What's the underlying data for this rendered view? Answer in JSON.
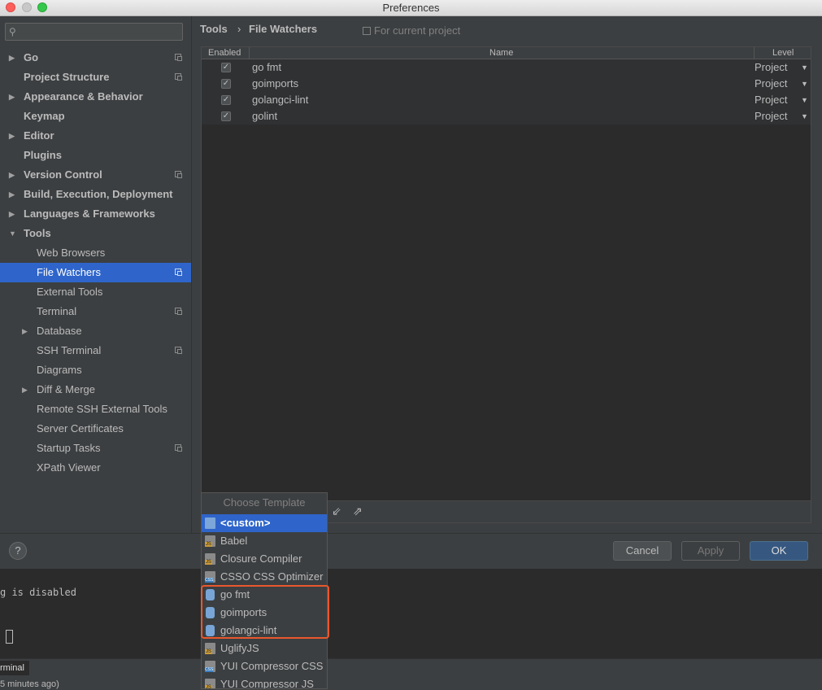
{
  "window": {
    "title": "Preferences"
  },
  "sidebar": {
    "search_placeholder": "",
    "items": [
      {
        "label": "Go",
        "arrow": "▶",
        "bold": true,
        "proj": true
      },
      {
        "label": "Project Structure",
        "arrow": "",
        "bold": true,
        "proj": true
      },
      {
        "label": "Appearance & Behavior",
        "arrow": "▶",
        "bold": true,
        "proj": false
      },
      {
        "label": "Keymap",
        "arrow": "",
        "bold": true,
        "proj": false
      },
      {
        "label": "Editor",
        "arrow": "▶",
        "bold": true,
        "proj": false
      },
      {
        "label": "Plugins",
        "arrow": "",
        "bold": true,
        "proj": false
      },
      {
        "label": "Version Control",
        "arrow": "▶",
        "bold": true,
        "proj": true
      },
      {
        "label": "Build, Execution, Deployment",
        "arrow": "▶",
        "bold": true,
        "proj": false
      },
      {
        "label": "Languages & Frameworks",
        "arrow": "▶",
        "bold": true,
        "proj": false
      },
      {
        "label": "Tools",
        "arrow": "▼",
        "bold": true,
        "proj": false
      },
      {
        "label": "Web Browsers",
        "arrow": "",
        "bold": false,
        "proj": false
      },
      {
        "label": "File Watchers",
        "arrow": "",
        "bold": false,
        "proj": true,
        "selected": true
      },
      {
        "label": "External Tools",
        "arrow": "",
        "bold": false,
        "proj": false
      },
      {
        "label": "Terminal",
        "arrow": "",
        "bold": false,
        "proj": true
      },
      {
        "label": "Database",
        "arrow": "▶",
        "bold": false,
        "proj": false
      },
      {
        "label": "SSH Terminal",
        "arrow": "",
        "bold": false,
        "proj": true
      },
      {
        "label": "Diagrams",
        "arrow": "",
        "bold": false,
        "proj": false
      },
      {
        "label": "Diff & Merge",
        "arrow": "▶",
        "bold": false,
        "proj": false
      },
      {
        "label": "Remote SSH External Tools",
        "arrow": "",
        "bold": false,
        "proj": false
      },
      {
        "label": "Server Certificates",
        "arrow": "",
        "bold": false,
        "proj": false
      },
      {
        "label": "Startup Tasks",
        "arrow": "",
        "bold": false,
        "proj": true
      },
      {
        "label": "XPath Viewer",
        "arrow": "",
        "bold": false,
        "proj": false
      }
    ]
  },
  "breadcrumb": {
    "parent": "Tools",
    "separator": "›",
    "current": "File Watchers",
    "scope": "For current project"
  },
  "table": {
    "headers": {
      "enabled": "Enabled",
      "name": "Name",
      "level": "Level"
    },
    "rows": [
      {
        "checked": "✓",
        "name": "go fmt",
        "level": "Project"
      },
      {
        "checked": "✓",
        "name": "goimports",
        "level": "Project"
      },
      {
        "checked": "✓",
        "name": "golangci-lint",
        "level": "Project"
      },
      {
        "checked": "✓",
        "name": "golint",
        "level": "Project"
      }
    ]
  },
  "footer_icons": {
    "import": "⇙",
    "export": "⇗"
  },
  "buttons": {
    "help": "?",
    "cancel": "Cancel",
    "apply": "Apply",
    "ok": "OK"
  },
  "popup": {
    "title": "Choose Template",
    "items": [
      {
        "label": "<custom>",
        "icon": "custom",
        "selected": true
      },
      {
        "label": "Babel",
        "icon": "js"
      },
      {
        "label": "Closure Compiler",
        "icon": "js"
      },
      {
        "label": "CSSO CSS Optimizer",
        "icon": "css"
      },
      {
        "label": "go fmt",
        "icon": "go"
      },
      {
        "label": "goimports",
        "icon": "go"
      },
      {
        "label": "golangci-lint",
        "icon": "go"
      },
      {
        "label": "UglifyJS",
        "icon": "js"
      },
      {
        "label": "YUI Compressor CSS",
        "icon": "css"
      },
      {
        "label": "YUI Compressor JS",
        "icon": "js"
      }
    ]
  },
  "terminal": {
    "line1": "g is disabled",
    "tab_label": "rminal",
    "status": "5 minutes ago)"
  },
  "colors": {
    "selection": "#2f65ca",
    "highlight_border": "#e9572d",
    "ok_button": "#365880"
  }
}
